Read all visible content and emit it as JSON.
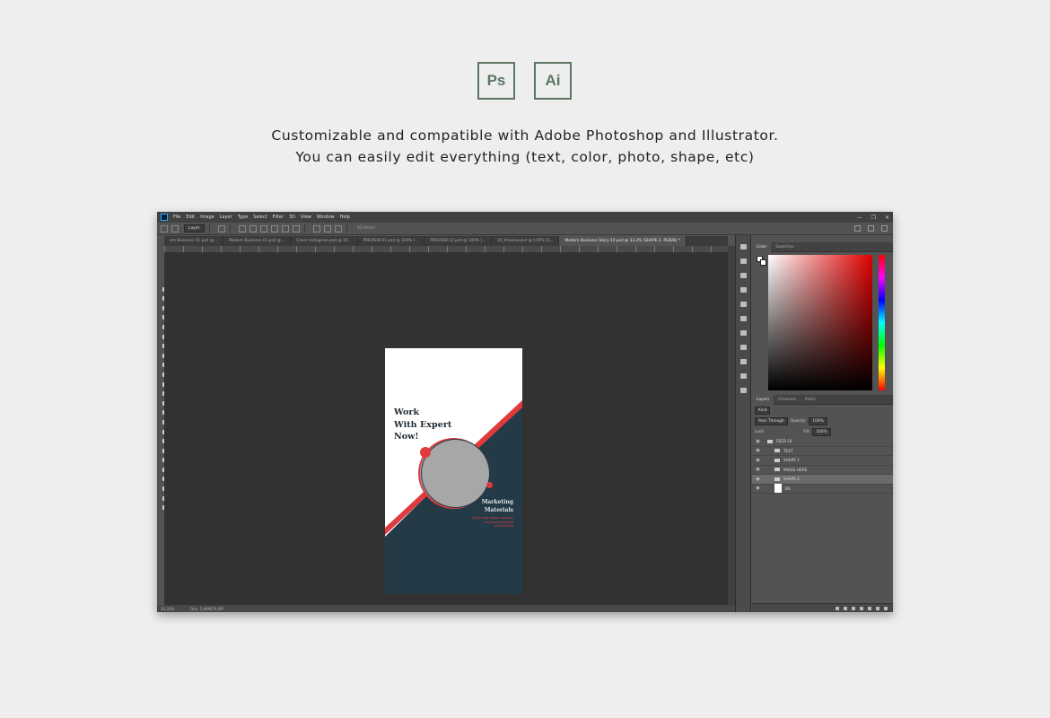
{
  "promo": {
    "ps_logo": "Ps",
    "ai_logo": "Ai",
    "line1": "Customizable and compatible with Adobe Photoshop and Illustrator.",
    "line2": "You can easily edit everything (text, color, photo, shape, etc)"
  },
  "menu": [
    "File",
    "Edit",
    "Image",
    "Layer",
    "Type",
    "Select",
    "Filter",
    "3D",
    "View",
    "Window",
    "Help"
  ],
  "window_controls": [
    "—",
    "❐",
    "✕"
  ],
  "options": {
    "layer_dropdown": "Layer",
    "mode_3d": "3D Mode:"
  },
  "tabs": [
    "ern Business 01.psd @...",
    "Modern Business 01.psd @...",
    "Cover Instagram.psd @ 10...",
    "PREVIEW 01.psd @ 100% (...",
    "PREVIEW 02.psd @ 100% (...",
    "04_Preview.psd @ 100% (S...",
    "Modern Business Story-10.psd @ 33,3% (SHAPE 2, RGB/8) *"
  ],
  "active_tab_index": 6,
  "status": {
    "zoom": "33,33%",
    "doc": "Doc: 5,94M/19,4M"
  },
  "artwork": {
    "headline": [
      "Work",
      "With Expert",
      "Now!"
    ],
    "subtitle": [
      "Marketing",
      "Materials"
    ],
    "small": [
      "Every large design company",
      "has great marketing",
      "and branding"
    ],
    "colors": {
      "navy": "#253a47",
      "red": "#e13a3e",
      "photo": "#a7a7a7"
    }
  },
  "color_panel": {
    "tabs": [
      "Color",
      "Swatches"
    ]
  },
  "layers_panel": {
    "tabs": [
      "Layers",
      "Channels",
      "Paths"
    ],
    "kind": "Kind",
    "blend": "Pass Through",
    "opacity_label": "Opacity:",
    "opacity": "100%",
    "lock_label": "Lock:",
    "fill_label": "Fill:",
    "fill": "100%",
    "layers": [
      {
        "name": "FEED 10",
        "type": "group",
        "indent": 0
      },
      {
        "name": "TEXT",
        "type": "group",
        "indent": 1
      },
      {
        "name": "SHAPE 1",
        "type": "group",
        "indent": 1
      },
      {
        "name": "IMAGE HERE",
        "type": "group",
        "indent": 1
      },
      {
        "name": "SHAPE 2",
        "type": "group",
        "indent": 1,
        "selected": true
      },
      {
        "name": "BG",
        "type": "layer",
        "indent": 0
      }
    ]
  }
}
